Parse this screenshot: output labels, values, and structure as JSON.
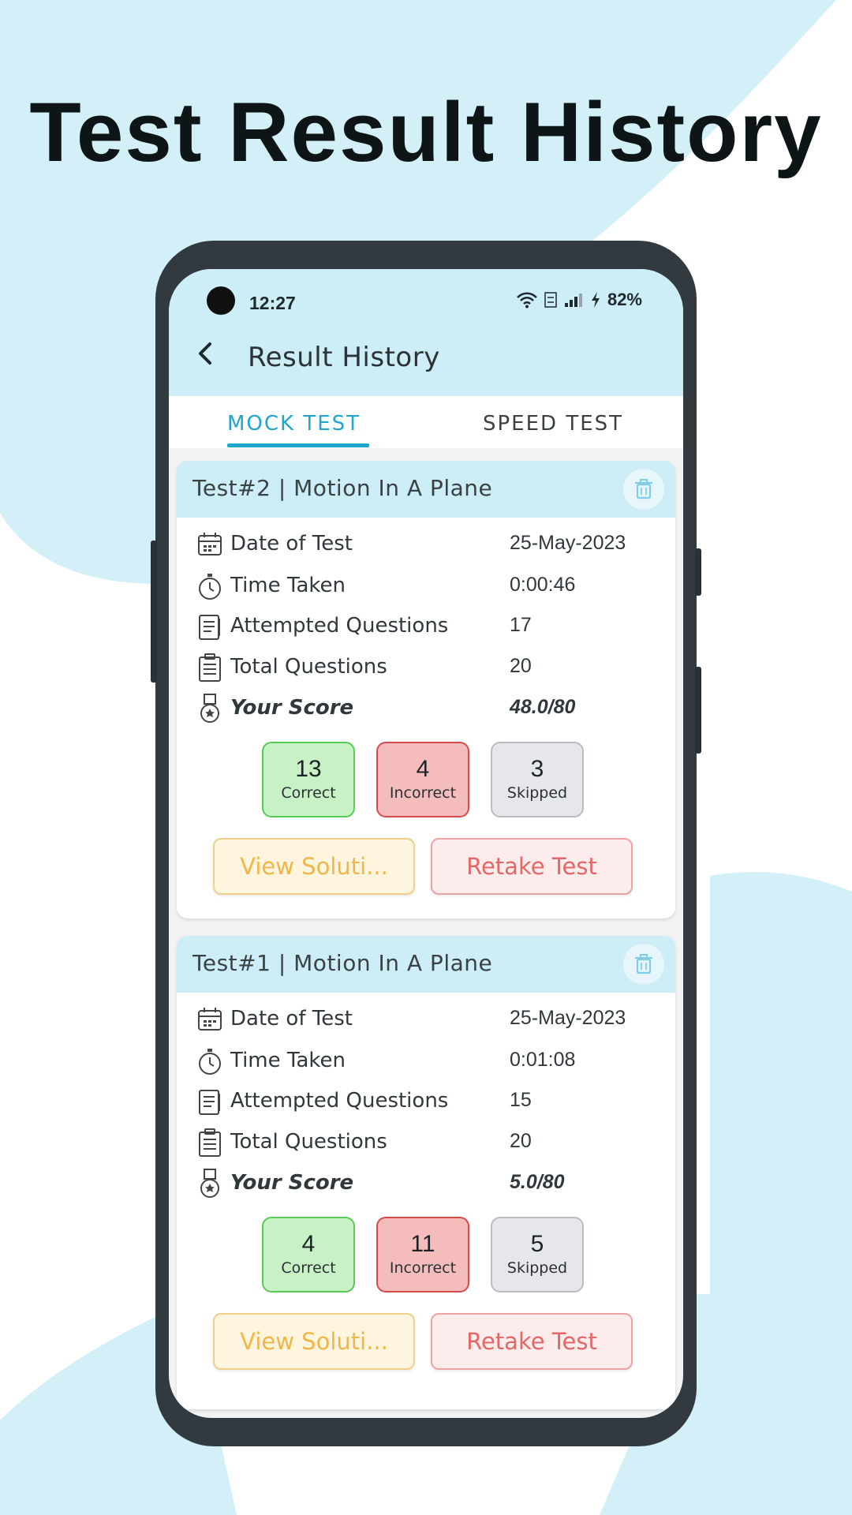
{
  "headline": "Test Result History",
  "colors": {
    "accent": "#1fa6cc",
    "appbar": "#cdeef7",
    "correct": "#59c957",
    "incorrect": "#d64a4a",
    "skipped": "#b9bcc2",
    "background_blob": "#d3f0f8"
  },
  "status_bar": {
    "time": "12:27",
    "battery": "82%",
    "icons": [
      "wifi-icon",
      "volte-icon",
      "signal-icon",
      "charging-icon"
    ]
  },
  "app_bar": {
    "back_icon": "chevron-left-icon",
    "title": "Result History"
  },
  "tabs": [
    {
      "label": "MOCK TEST",
      "active": true
    },
    {
      "label": "SPEED TEST",
      "active": false
    }
  ],
  "cards": [
    {
      "title": "Test#2 | Motion In A Plane",
      "rows": [
        {
          "icon": "calendar-icon",
          "label": "Date of Test",
          "value": "25-May-2023"
        },
        {
          "icon": "stopwatch-icon",
          "label": "Time Taken",
          "value": "0:00:46"
        },
        {
          "icon": "notepad-icon",
          "label": "Attempted Questions",
          "value": "17"
        },
        {
          "icon": "clipboard-icon",
          "label": "Total Questions",
          "value": "20"
        },
        {
          "icon": "medal-icon",
          "label": "Your Score",
          "value": "48.0/80"
        }
      ],
      "stats": [
        {
          "value": "13",
          "label": "Correct"
        },
        {
          "value": "4",
          "label": "Incorrect"
        },
        {
          "value": "3",
          "label": "Skipped"
        }
      ],
      "view_label": "View Soluti...",
      "retake_label": "Retake Test"
    },
    {
      "title": "Test#1 | Motion In A Plane",
      "rows": [
        {
          "icon": "calendar-icon",
          "label": "Date of Test",
          "value": "25-May-2023"
        },
        {
          "icon": "stopwatch-icon",
          "label": "Time Taken",
          "value": "0:01:08"
        },
        {
          "icon": "notepad-icon",
          "label": "Attempted Questions",
          "value": "15"
        },
        {
          "icon": "clipboard-icon",
          "label": "Total Questions",
          "value": "20"
        },
        {
          "icon": "medal-icon",
          "label": "Your Score",
          "value": "5.0/80"
        }
      ],
      "stats": [
        {
          "value": "4",
          "label": "Correct"
        },
        {
          "value": "11",
          "label": "Incorrect"
        },
        {
          "value": "5",
          "label": "Skipped"
        }
      ],
      "view_label": "View Soluti...",
      "retake_label": "Retake Test"
    }
  ]
}
